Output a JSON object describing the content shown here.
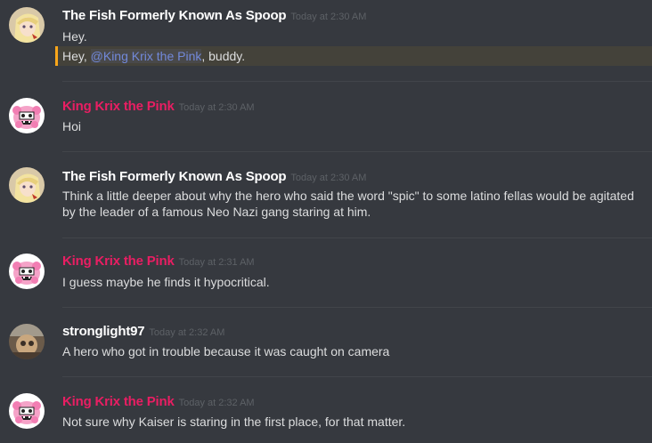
{
  "messages": [
    {
      "author": "The Fish Formerly Known As Spoop",
      "timestamp": "Today at 2:30 AM",
      "avatar_icon": "anime-girl-avatar-icon",
      "lines": [
        "Hey."
      ],
      "mention_line": {
        "prefix": "Hey, ",
        "mention": "@King Krix the Pink",
        "suffix": ", buddy."
      }
    },
    {
      "author": "King Krix the Pink",
      "timestamp": "Today at 2:30 AM",
      "avatar_icon": "pink-monster-avatar-icon",
      "lines": [
        "Hoi"
      ]
    },
    {
      "author": "The Fish Formerly Known As Spoop",
      "timestamp": "Today at 2:30 AM",
      "avatar_icon": "anime-girl-avatar-icon",
      "lines": [
        "Think a little deeper about why the hero who said the word \"spic\" to some latino fellas would be agitated",
        "by the leader of a famous Neo Nazi gang staring at him."
      ]
    },
    {
      "author": "King Krix the Pink",
      "timestamp": "Today at 2:31 AM",
      "avatar_icon": "pink-monster-avatar-icon",
      "lines": [
        "I guess maybe he finds it hypocritical."
      ]
    },
    {
      "author": "stronglight97",
      "timestamp": "Today at 2:32 AM",
      "avatar_icon": "blurry-photo-avatar-icon",
      "lines": [
        "A hero who got in trouble because it was caught on camera"
      ]
    },
    {
      "author": "King Krix the Pink",
      "timestamp": "Today at 2:32 AM",
      "avatar_icon": "pink-monster-avatar-icon",
      "lines": [
        "Not sure why Kaiser is staring in the first place, for that matter."
      ]
    }
  ],
  "colors": {
    "background": "#36393f",
    "username_default": "#ffffff",
    "username_pink": "#e91e63",
    "mention": "#7289da",
    "mention_highlight_bar": "#faa61a"
  }
}
